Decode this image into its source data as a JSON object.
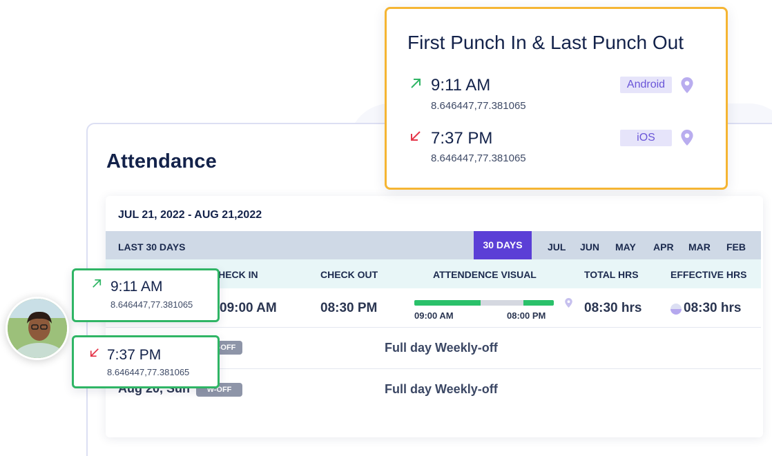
{
  "popup": {
    "title": "First Punch In & Last Punch Out",
    "punch_in": {
      "time": "9:11 AM",
      "coords": "8.646447,77.381065",
      "device": "Android"
    },
    "punch_out": {
      "time": "7:37 PM",
      "coords": "8.646447,77.381065",
      "device": "iOS"
    }
  },
  "attendance": {
    "title": "Attendance",
    "date_range": "JUL 21, 2022 - AUG 21,2022",
    "filter_label": "LAST 30 DAYS",
    "active_filter": "30 DAYS",
    "months": [
      "JUL",
      "JUN",
      "MAY",
      "APR",
      "MAR",
      "FEB"
    ],
    "columns": {
      "check_in": "CHECK IN",
      "check_out": "CHECK OUT",
      "visual": "ATTENDENCE VISUAL",
      "total": "TOTAL HRS",
      "effective": "EFFECTIVE HRS"
    },
    "row1": {
      "check_in": "09:00 AM",
      "check_out": "08:30 PM",
      "visual_start": "09:00 AM",
      "visual_end": "08:00 PM",
      "total": "08:30 hrs",
      "effective": "08:30 hrs"
    },
    "row2": {
      "badge": "W-OFF",
      "status": "Full day Weekly-off"
    },
    "row3": {
      "date": "Aug 20, Sun",
      "badge": "W-OFF",
      "status": "Full day Weekly-off"
    }
  },
  "overlay_cards": {
    "in": {
      "time": "9:11 AM",
      "coords": "8.646447,77.381065"
    },
    "out": {
      "time": "7:37 PM",
      "coords": "8.646447,77.381065"
    }
  },
  "colors": {
    "accent": "#5b3fd6",
    "popup_border": "#f5b533",
    "card_border": "#2fb565",
    "in_arrow": "#2fb565",
    "out_arrow": "#e5364a"
  }
}
